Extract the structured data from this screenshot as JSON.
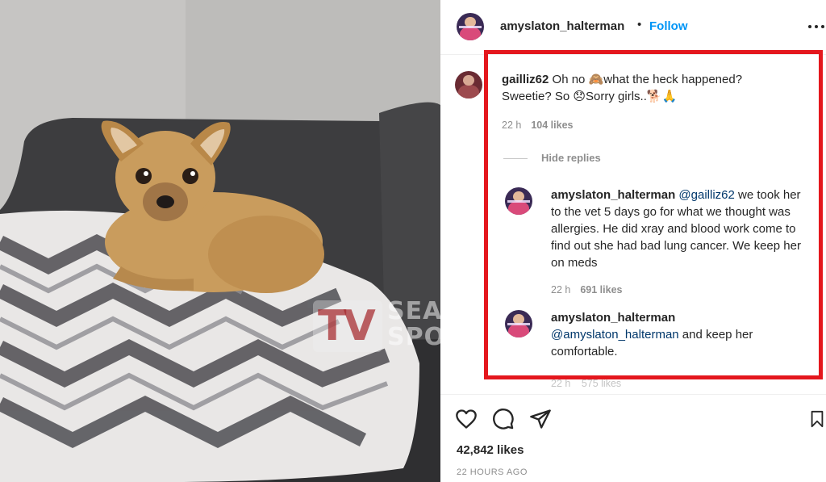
{
  "photo": {
    "alt_subject": "dog",
    "watermark": {
      "logo": "TV",
      "line1": "SEASON",
      "line2": "SPOIL"
    }
  },
  "post": {
    "author": "amyslaton_halterman",
    "separator": "•",
    "follow_label": "Follow",
    "more_icon": "more-options-icon"
  },
  "comments": [
    {
      "username": "gailliz62",
      "text": "Oh no 🙈what the heck happened? Sweetie? So 😞Sorry girls..🐕🙏",
      "time": "22 h",
      "likes": "104 likes"
    }
  ],
  "hide_replies_label": "Hide replies",
  "replies": [
    {
      "username": "amyslaton_halterman",
      "mention": "@gailliz62",
      "text": " we took her to the vet 5 days go for what we thought was allergies. He did xray and blood work come to find out she had bad lung cancer. We keep her on meds",
      "time": "22 h",
      "likes": "691 likes"
    },
    {
      "username": "amyslaton_halterman",
      "mention": "@amyslaton_halterman",
      "text": " and keep her comfortable.",
      "time": "22 h",
      "likes": "575 likes"
    }
  ],
  "footer": {
    "likes_count": "42,842 likes",
    "posted_ago": "22 HOURS AGO"
  },
  "colors": {
    "highlight_box": "#e4171d",
    "follow_blue": "#0095f6",
    "mention_blue": "#00376b",
    "meta_gray": "#8e8e8e"
  }
}
